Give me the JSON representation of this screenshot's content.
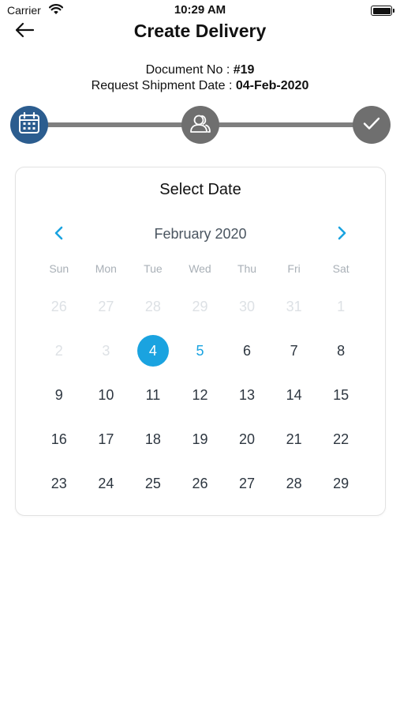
{
  "status_bar": {
    "carrier": "Carrier",
    "time": "10:29 AM"
  },
  "nav": {
    "title": "Create Delivery",
    "back_icon": "arrow-left-icon"
  },
  "document": {
    "doc_no_label": "Document No : ",
    "doc_no_value": "#19",
    "ship_date_label": "Request Shipment Date : ",
    "ship_date_value": "04-Feb-2020"
  },
  "stepper": {
    "steps": [
      {
        "icon": "calendar-icon",
        "state": "active",
        "color": "#2c5d8f"
      },
      {
        "icon": "users-icon",
        "state": "inactive",
        "color": "#6f6f6f"
      },
      {
        "icon": "check-icon",
        "state": "inactive",
        "color": "#6f6f6f"
      }
    ]
  },
  "calendar": {
    "title": "Select Date",
    "month_label": "February 2020",
    "accent_color": "#1aa3e0",
    "weekdays": [
      "Sun",
      "Mon",
      "Tue",
      "Wed",
      "Thu",
      "Fri",
      "Sat"
    ],
    "days": [
      {
        "label": "26",
        "state": "muted"
      },
      {
        "label": "27",
        "state": "muted"
      },
      {
        "label": "28",
        "state": "muted"
      },
      {
        "label": "29",
        "state": "muted"
      },
      {
        "label": "30",
        "state": "muted"
      },
      {
        "label": "31",
        "state": "muted"
      },
      {
        "label": "1",
        "state": "muted"
      },
      {
        "label": "2",
        "state": "muted"
      },
      {
        "label": "3",
        "state": "muted"
      },
      {
        "label": "4",
        "state": "selected"
      },
      {
        "label": "5",
        "state": "today"
      },
      {
        "label": "6",
        "state": "normal"
      },
      {
        "label": "7",
        "state": "normal"
      },
      {
        "label": "8",
        "state": "normal"
      },
      {
        "label": "9",
        "state": "normal"
      },
      {
        "label": "10",
        "state": "normal"
      },
      {
        "label": "11",
        "state": "normal"
      },
      {
        "label": "12",
        "state": "normal"
      },
      {
        "label": "13",
        "state": "normal"
      },
      {
        "label": "14",
        "state": "normal"
      },
      {
        "label": "15",
        "state": "normal"
      },
      {
        "label": "16",
        "state": "normal"
      },
      {
        "label": "17",
        "state": "normal"
      },
      {
        "label": "18",
        "state": "normal"
      },
      {
        "label": "19",
        "state": "normal"
      },
      {
        "label": "20",
        "state": "normal"
      },
      {
        "label": "21",
        "state": "normal"
      },
      {
        "label": "22",
        "state": "normal"
      },
      {
        "label": "23",
        "state": "normal"
      },
      {
        "label": "24",
        "state": "normal"
      },
      {
        "label": "25",
        "state": "normal"
      },
      {
        "label": "26",
        "state": "normal"
      },
      {
        "label": "27",
        "state": "normal"
      },
      {
        "label": "28",
        "state": "normal"
      },
      {
        "label": "29",
        "state": "normal"
      }
    ]
  }
}
